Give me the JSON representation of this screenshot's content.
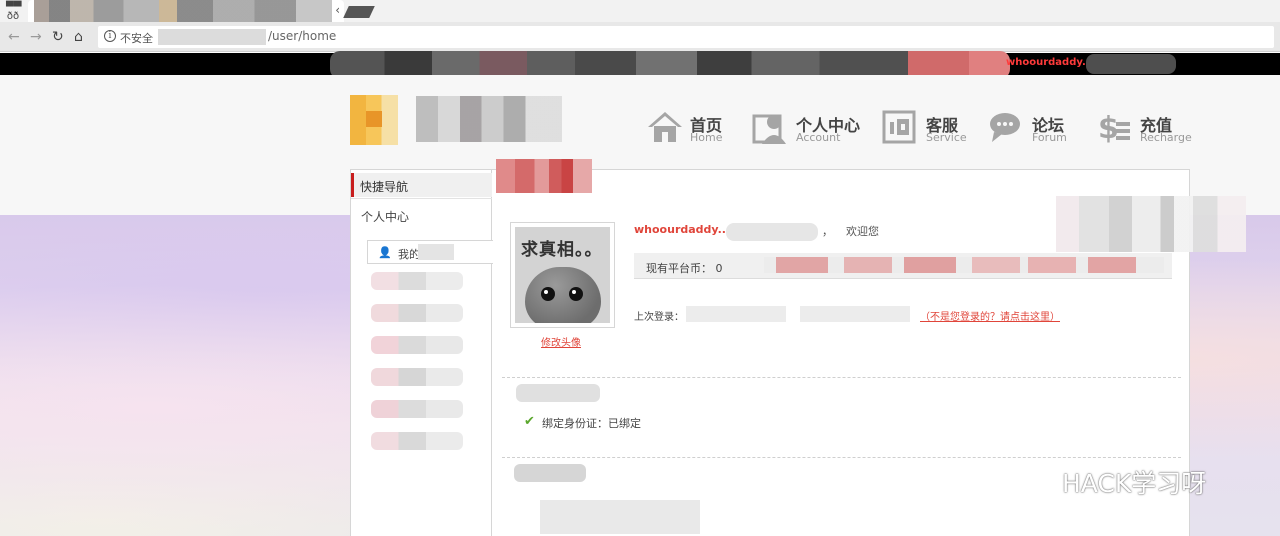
{
  "browser": {
    "insecure_label": "不安全",
    "url_path": "/user/home",
    "tab_close": "‹"
  },
  "topbar": {
    "username": "whoourdaddy.."
  },
  "nav": [
    {
      "cn": "首页",
      "en": "Home",
      "icon": "home-icon"
    },
    {
      "cn": "个人中心",
      "en": "Account",
      "icon": "account-icon"
    },
    {
      "cn": "客服",
      "en": "Service",
      "icon": "service-icon"
    },
    {
      "cn": "论坛",
      "en": "Forum",
      "icon": "forum-icon"
    },
    {
      "cn": "充值",
      "en": "Recharge",
      "icon": "recharge-icon"
    }
  ],
  "sidebar": {
    "heading": "快捷导航",
    "section": "个人中心",
    "active_item": "我的"
  },
  "avatar": {
    "caption_text": "求真相。。",
    "change_label": "修改头像"
  },
  "user": {
    "name": "whoourdaddy..",
    "comma": "，",
    "welcome": "欢迎您",
    "coin_label": "现有平台币：",
    "coin_value": "0",
    "last_login_label": "上次登录：",
    "not_you_link": "（不是您登录的？请点击这里）",
    "id_bound_text": "绑定身份证：已绑定"
  },
  "watermark": {
    "text": "HACK学习呀"
  },
  "colors": {
    "accent_red": "#e0453a",
    "check_green": "#5aa72c"
  }
}
